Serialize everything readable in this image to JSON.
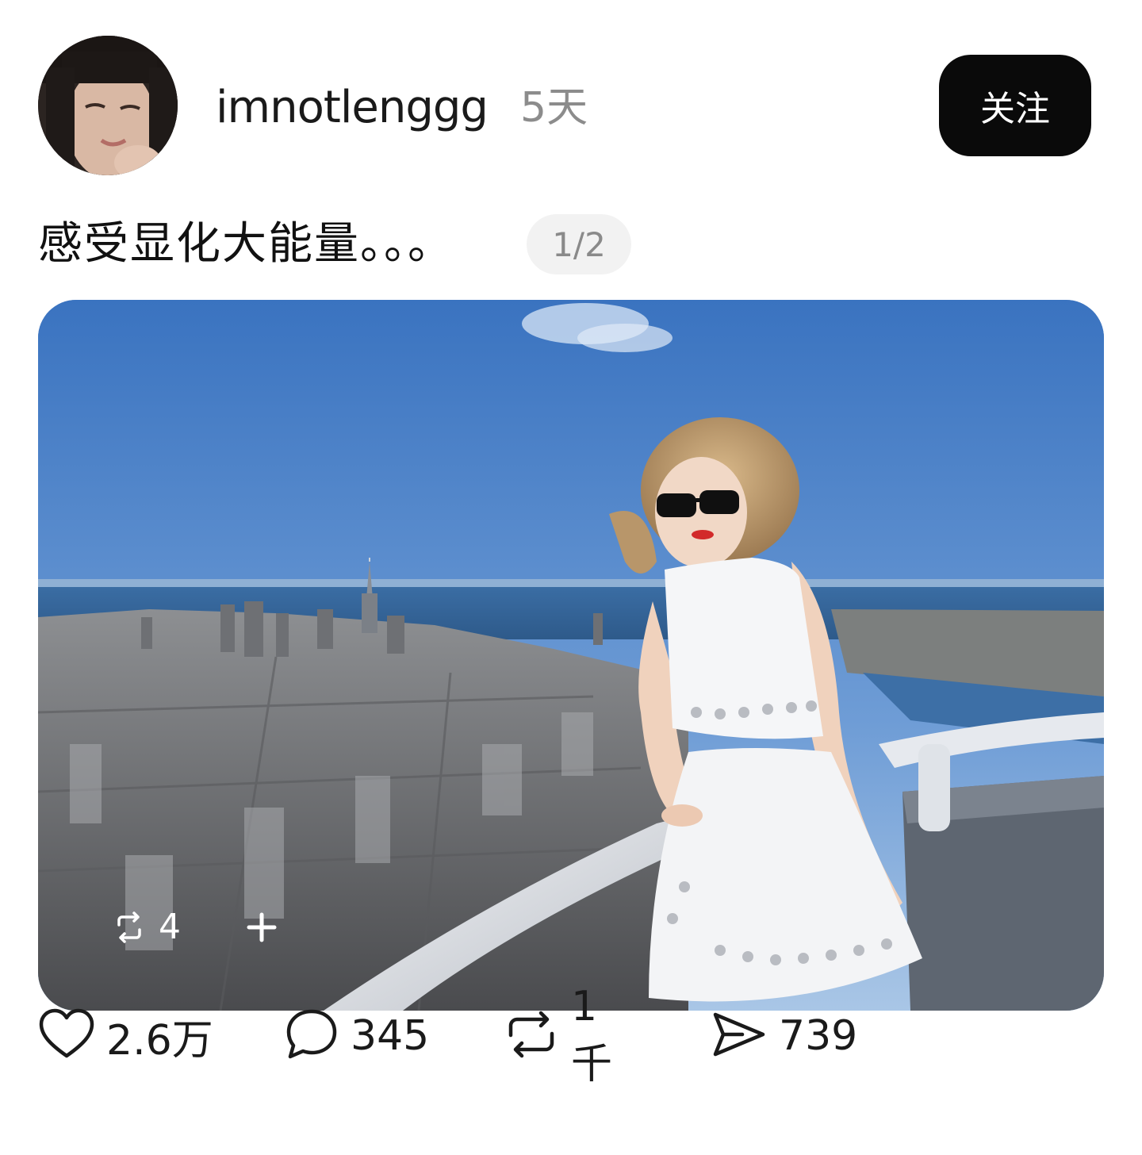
{
  "post": {
    "username": "imnotlenggg",
    "time_ago": "5天",
    "follow_label": "关注",
    "caption": "感受显化大能量。。。",
    "page_indicator": "1/2"
  },
  "photo_overlay": {
    "repost_icon": "repost-icon",
    "repost_count": "4",
    "add_icon": "plus-icon"
  },
  "actions": {
    "like": {
      "icon": "heart-icon",
      "count": "2.6万"
    },
    "comment": {
      "icon": "comment-bubble-icon",
      "count": "345"
    },
    "repost": {
      "icon": "repost-icon",
      "count": "1千"
    },
    "share": {
      "icon": "send-icon",
      "count": "739"
    }
  },
  "colors": {
    "follow_button_bg": "#0a0a0a",
    "secondary_text": "#8c8c8c",
    "sky": "#3f77c2"
  }
}
